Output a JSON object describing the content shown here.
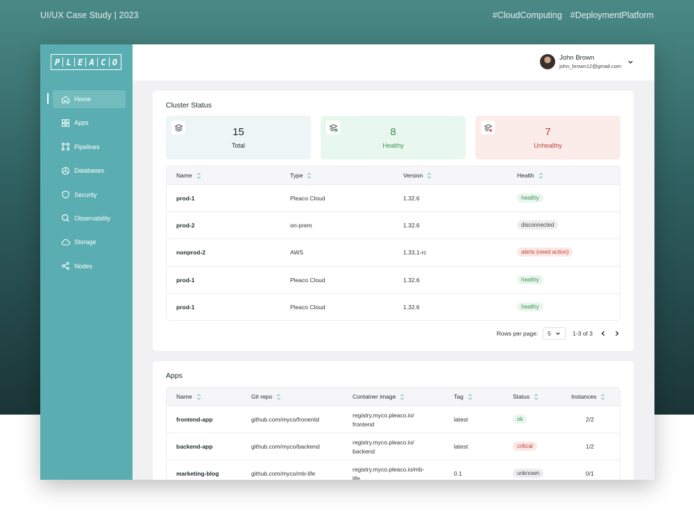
{
  "header": {
    "left_text": "UI/UX Case Study | 2023",
    "tag1": "#CloudComputing",
    "tag2": "#DeploymentPlatform"
  },
  "logo": {
    "letters": [
      "P",
      "L",
      "E",
      "A",
      "C",
      "O"
    ]
  },
  "nav": [
    {
      "label": "Home",
      "icon": "home-icon",
      "active": true
    },
    {
      "label": "Apps",
      "icon": "grid-icon"
    },
    {
      "label": "Pipelines",
      "icon": "pipeline-icon"
    },
    {
      "label": "Databases",
      "icon": "database-icon"
    },
    {
      "label": "Security",
      "icon": "shield-icon"
    },
    {
      "label": "Observability",
      "icon": "search-icon"
    },
    {
      "label": "Storage",
      "icon": "cloud-icon"
    },
    {
      "label": "Nodes",
      "icon": "share-icon"
    }
  ],
  "user": {
    "name": "John Brown",
    "email": "john_brown12@gmail.com"
  },
  "cluster": {
    "title": "Cluster Status",
    "stats": [
      {
        "value": "15",
        "label": "Total"
      },
      {
        "value": "8",
        "label": "Healthy"
      },
      {
        "value": "7",
        "label": "Unhealthy"
      }
    ],
    "columns": [
      "Name",
      "Type",
      "Version",
      "Health"
    ],
    "rows": [
      {
        "name": "prod-1",
        "type": "Pleaco Cloud",
        "version": "1.32.6",
        "health": "healthy",
        "status": "healthy"
      },
      {
        "name": "prod-2",
        "type": "on-prem",
        "version": "1.32.6",
        "health": "disconnected",
        "status": "neutral"
      },
      {
        "name": "nonprod-2",
        "type": "AWS",
        "version": "1.33.1-rc",
        "health": "alerts (need action)",
        "status": "alert"
      },
      {
        "name": "prod-1",
        "type": "Pleaco Cloud",
        "version": "1.32.6",
        "health": "healthy",
        "status": "healthy"
      },
      {
        "name": "prod-1",
        "type": "Pleaco Cloud",
        "version": "1.32.6",
        "health": "healthy",
        "status": "healthy"
      }
    ],
    "pagination": {
      "rows_label": "Rows per page:",
      "rows_value": "5",
      "range": "1-3 of 3"
    }
  },
  "apps": {
    "title": "Apps",
    "columns": [
      "Name",
      "Git repo",
      "Container image",
      "Tag",
      "Status",
      "Instances"
    ],
    "rows": [
      {
        "name": "frontend-app",
        "repo": "github.com/myco/fronentd",
        "image1": "registry.myco.pleaco.io/",
        "image2": "frontend",
        "tag": "latest",
        "status": "ok",
        "status_kind": "healthy",
        "instances": "2/2"
      },
      {
        "name": "backend-app",
        "repo": "github.com/myco/backend",
        "image1": "registry.myco.pleaco.io/",
        "image2": "backend",
        "tag": "latest",
        "status": "critical",
        "status_kind": "alert",
        "instances": "1/2"
      },
      {
        "name": "marketing-blog",
        "repo": "github.com/myco/mb-life",
        "image1": "registry.myco.pleaco.io/mb-",
        "image2": "life",
        "tag": "0.1",
        "status": "unknown",
        "status_kind": "neutral",
        "instances": "0/1"
      }
    ]
  },
  "colors": {
    "sidebar": "#5aaeb1",
    "total_bg": "#edf5f5",
    "healthy_bg": "#e9f8ee",
    "healthy_text": "#3f8f56",
    "unhealthy_bg": "#fbecea",
    "unhealthy_text": "#b8433b"
  }
}
